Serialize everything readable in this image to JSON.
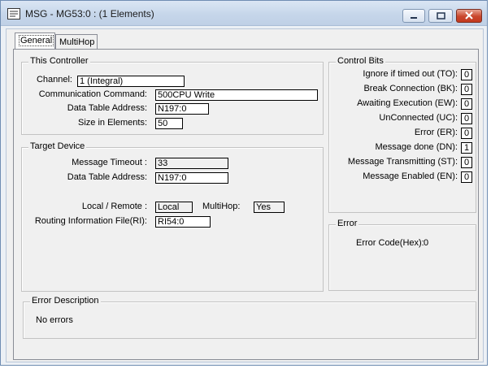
{
  "window": {
    "title": "MSG - MG53:0 : (1 Elements)"
  },
  "tabs": [
    {
      "label": "General"
    },
    {
      "label": "MultiHop"
    }
  ],
  "this_controller": {
    "legend": "This Controller",
    "channel_label": "Channel:",
    "channel_value": "1 (Integral)",
    "comm_label": "Communication Command:",
    "comm_value": "500CPU Write",
    "dta_label": "Data Table Address:",
    "dta_value": "N197:0",
    "size_label": "Size in Elements:",
    "size_value": "50"
  },
  "target_device": {
    "legend": "Target Device",
    "timeout_label": "Message Timeout :",
    "timeout_value": "33",
    "dta_label": "Data Table Address:",
    "dta_value": "N197:0",
    "local_remote_label": "Local / Remote :",
    "local_remote_value": "Local",
    "multihop_label": "MultiHop:",
    "multihop_value": "Yes",
    "routing_label": "Routing Information File(RI):",
    "routing_value": "RI54:0"
  },
  "control_bits": {
    "legend": "Control Bits",
    "items": [
      {
        "label": "Ignore if timed out (TO):",
        "value": "0"
      },
      {
        "label": "Break Connection (BK):",
        "value": "0"
      },
      {
        "label": "Awaiting Execution (EW):",
        "value": "0"
      },
      {
        "label": "UnConnected (UC):",
        "value": "0"
      },
      {
        "label": "Error (ER):",
        "value": "0"
      },
      {
        "label": "Message done (DN):",
        "value": "1"
      },
      {
        "label": "Message Transmitting (ST):",
        "value": "0"
      },
      {
        "label": "Message Enabled (EN):",
        "value": "0"
      }
    ]
  },
  "error": {
    "legend": "Error",
    "code_label": "Error Code(Hex):",
    "code_value": "0"
  },
  "error_description": {
    "legend": "Error Description",
    "text": "No errors"
  }
}
